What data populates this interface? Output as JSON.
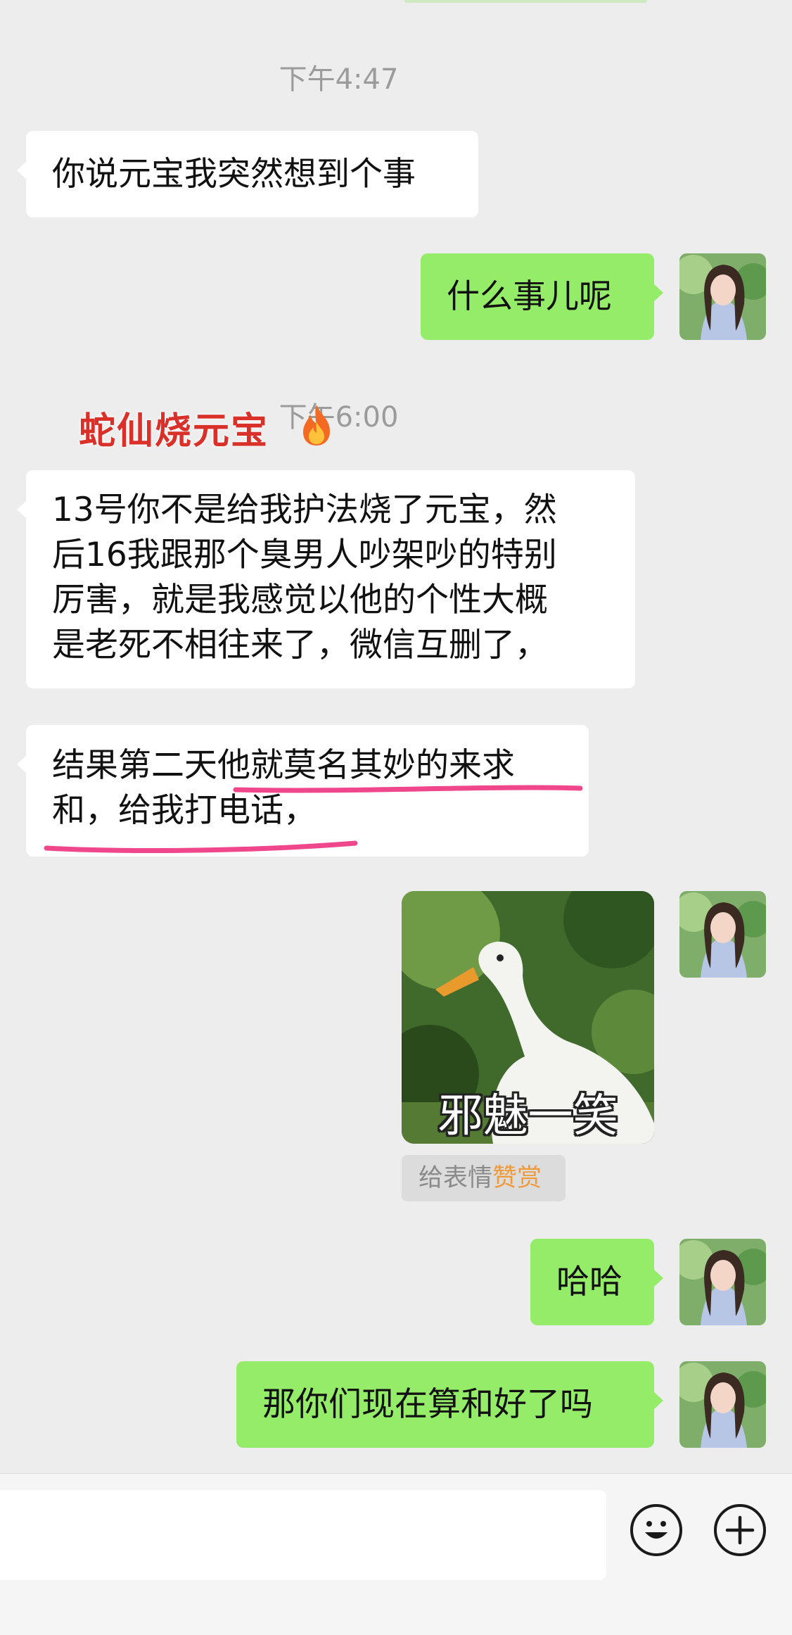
{
  "chat": {
    "timestamps": [
      "下午4:47",
      "下午6:00"
    ],
    "messages": {
      "m1": "你说元宝我突然想到个事",
      "m2": "什么事儿呢",
      "m3_lines": [
        "13号你不是给我护法烧了元宝，然",
        "后16我跟那个臭男人吵架吵的特别",
        "厉害，就是我感觉以他的个性大概",
        "是老死不相往来了，微信互删了，"
      ],
      "m4_lines": [
        "结果第二天他就莫名其妙的来求",
        "和，给我打电话，"
      ],
      "m5": "哈哈",
      "m6": "那你们现在算和好了吗"
    },
    "sticker_caption": "邪魅一笑",
    "reward": {
      "prefix": "给表情",
      "accent": "赞赏"
    }
  },
  "overlay": {
    "caption": "蛇仙烧元宝",
    "icon": "fire-icon"
  },
  "toolbar": {
    "emoji_icon": "smiley-icon",
    "more_icon": "plus-circle-icon"
  },
  "colors": {
    "background": "#ededed",
    "incoming_bubble": "#ffffff",
    "outgoing_bubble": "#95ec69",
    "underline": "#f0468c",
    "caption": "#d9312a",
    "reward_accent": "#f09a3a"
  }
}
